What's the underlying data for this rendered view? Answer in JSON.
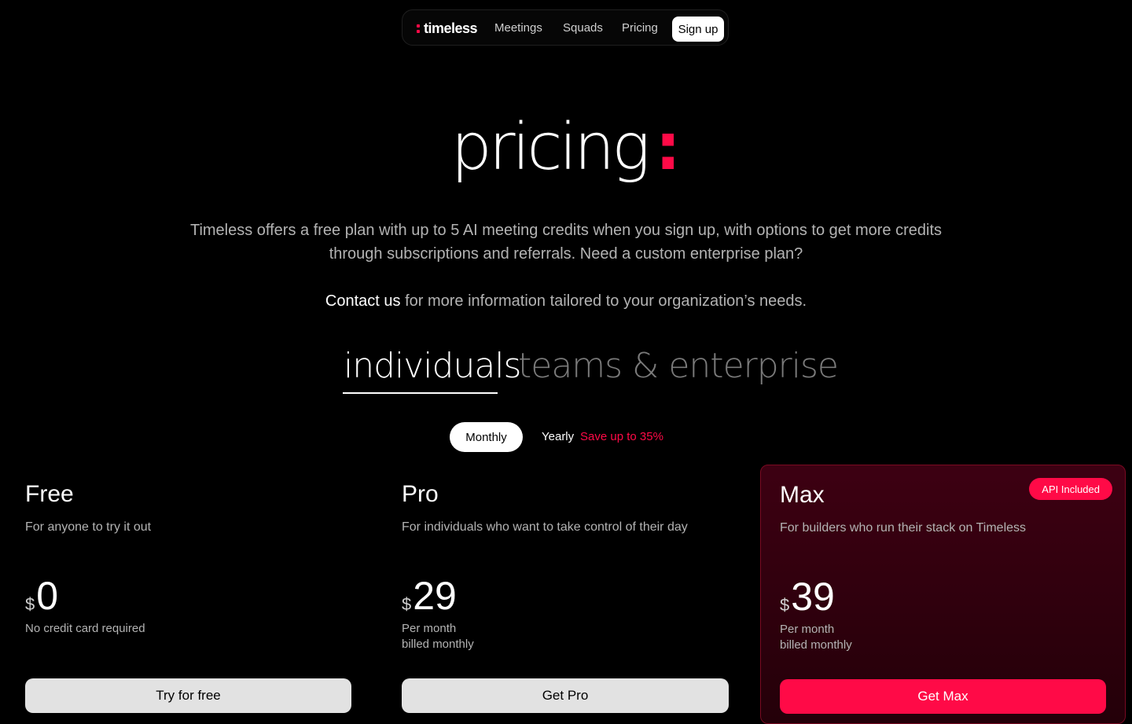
{
  "nav": {
    "logo": "timeless",
    "links": [
      "Meetings",
      "Squads",
      "Pricing"
    ],
    "signup": "Sign up"
  },
  "hero": {
    "title": "pricing",
    "colon": ":",
    "intro": "Timeless offers a free plan with up to 5 AI meeting credits when you sign up, with options to get more credits through subscriptions and referrals. Need a custom enterprise plan?",
    "contact_link": "Contact us",
    "contact_rest": " for more information tailored to your organization’s needs."
  },
  "tabs": {
    "individuals": "individuals",
    "teams": "teams & enterprise",
    "active": "individuals"
  },
  "billing": {
    "monthly": "Monthly",
    "yearly": "Yearly",
    "save": "Save up to 35%",
    "selected": "Monthly"
  },
  "plans": [
    {
      "name": "Free",
      "desc": "For anyone to try it out",
      "currency": "$",
      "price": "0",
      "note1": "No credit card required",
      "note2": "",
      "button": "Try for free"
    },
    {
      "name": "Pro",
      "desc": "For individuals who want to take control of their day",
      "currency": "$",
      "price": "29",
      "note1": "Per month",
      "note2": "billed monthly",
      "button": "Get Pro"
    },
    {
      "name": "Max",
      "desc": "For builders who run their stack on Timeless",
      "currency": "$",
      "price": "39",
      "note1": "Per month",
      "note2": "billed monthly",
      "button": "Get Max",
      "badge": "API Included"
    }
  ],
  "colors": {
    "accent": "#ff0a47",
    "background": "#000000",
    "card_max": "#3d0012"
  }
}
